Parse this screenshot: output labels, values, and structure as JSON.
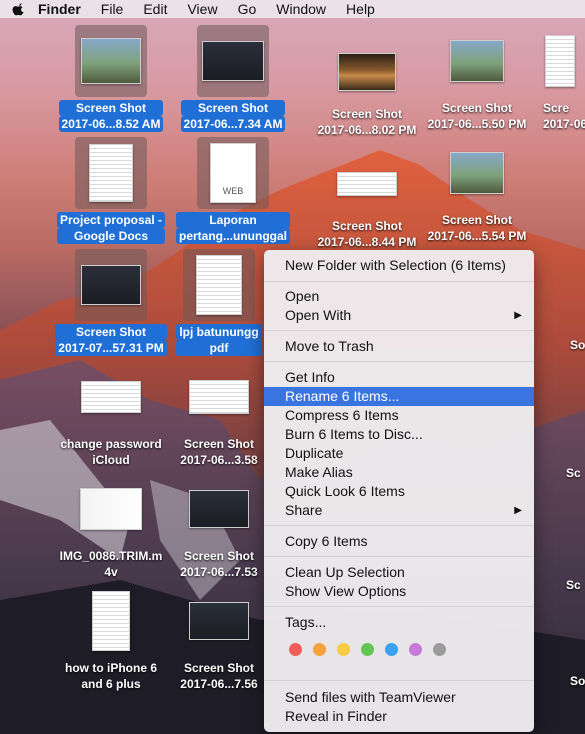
{
  "menubar": {
    "app": "Finder",
    "items": [
      "File",
      "Edit",
      "View",
      "Go",
      "Window",
      "Help"
    ]
  },
  "desktop_icons": [
    {
      "line1": "Screen Shot",
      "line2": "2017-06...8.52 AM",
      "selected": true,
      "thumb": "photo-group"
    },
    {
      "line1": "Screen Shot",
      "line2": "2017-06...7.34 AM",
      "selected": true,
      "thumb": "screenshot"
    },
    {
      "line1": "Screen Shot",
      "line2": "2017-06...8.02 PM",
      "selected": false,
      "thumb": "desert"
    },
    {
      "line1": "Screen Shot",
      "line2": "2017-06...5.50 PM",
      "selected": false,
      "thumb": "stack"
    },
    {
      "line1": "Scre",
      "line2": "2017-06",
      "selected": false,
      "thumb": "doc"
    },
    {
      "line1": "Project proposal -",
      "line2": "Google Docs",
      "selected": true,
      "thumb": "doc"
    },
    {
      "line1": "Laporan",
      "line2": "pertang...unun​ggal",
      "selected": true,
      "thumb": "web"
    },
    {
      "line1": "Screen Shot",
      "line2": "2017-06...8.44 PM",
      "selected": false,
      "thumb": "wide"
    },
    {
      "line1": "Screen Shot",
      "line2": "2017-06...5.54 PM",
      "selected": false,
      "thumb": "stack"
    },
    {
      "line1": "Screen Shot",
      "line2": "2017-07...57.31 PM",
      "selected": true,
      "thumb": "screenshot"
    },
    {
      "line1": "lpj batunungg",
      "line2": "pdf",
      "selected": true,
      "thumb": "doc"
    },
    {
      "line1": "change password",
      "line2": "iCloud",
      "selected": false,
      "thumb": "wide"
    },
    {
      "line1": "Screen Shot",
      "line2": "2017-06...3.58",
      "selected": false,
      "thumb": "wide"
    },
    {
      "line1": "IMG_0086.TRIM.m",
      "line2": "4v",
      "selected": false,
      "thumb": "chart"
    },
    {
      "line1": "Screen Shot",
      "line2": "2017-06...7.53",
      "selected": false,
      "thumb": "screenshot"
    },
    {
      "line1": "how to iPhone 6",
      "line2": "and 6 plus",
      "selected": false,
      "thumb": "phone"
    },
    {
      "line1": "Screen Shot",
      "line2": "2017-06...7.56",
      "selected": false,
      "thumb": "screenshot"
    }
  ],
  "edge_labels": [
    "So",
    "Sc",
    "Sc",
    "Sc",
    "Sc",
    "Sc",
    "Sc",
    "So"
  ],
  "context_menu": {
    "new_folder": "New Folder with Selection (6 Items)",
    "open": "Open",
    "open_with": "Open With",
    "move_to_trash": "Move to Trash",
    "get_info": "Get Info",
    "rename": "Rename 6 Items...",
    "compress": "Compress 6 Items",
    "burn": "Burn 6 Items to Disc...",
    "duplicate": "Duplicate",
    "make_alias": "Make Alias",
    "quick_look": "Quick Look 6 Items",
    "share": "Share",
    "copy": "Copy 6 Items",
    "clean_up": "Clean Up Selection",
    "show_view_options": "Show View Options",
    "tags": "Tags...",
    "tag_colors": [
      "#f25d5a",
      "#f7a23b",
      "#f6cd42",
      "#62c554",
      "#3ca2f0",
      "#c77ad9",
      "#9a9a9a"
    ],
    "teamviewer": "Send files with TeamViewer",
    "reveal": "Reveal in Finder",
    "highlight_color": "#3a74e0"
  },
  "web_badge": "WEB"
}
